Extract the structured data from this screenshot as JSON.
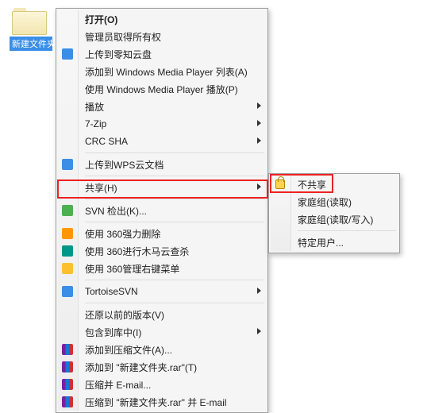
{
  "desktop": {
    "folder_label": "新建文件夹"
  },
  "menu": {
    "open": "打开(O)",
    "admin_owner": "管理员取得所有权",
    "upload_cloud": "上传到零知云盘",
    "wmp_list": "添加到 Windows Media Player 列表(A)",
    "wmp_play": "使用 Windows Media Player 播放(P)",
    "play": "播放",
    "seven_zip": "7-Zip",
    "crc_sha": "CRC SHA",
    "upload_wps": "上传到WPS云文档",
    "share": "共享(H)",
    "svn_checkout": "SVN 检出(K)...",
    "use_360_force_delete": "使用 360强力删除",
    "use_360_trojan_scan": "使用 360进行木马云查杀",
    "use_360_context_menu": "使用 360管理右键菜单",
    "tortoise_svn": "TortoiseSVN",
    "restore_previous": "还原以前的版本(V)",
    "include_in_library": "包含到库中(I)",
    "add_to_archive": "添加到压缩文件(A)...",
    "add_to_named_rar": "添加到 \"新建文件夹.rar\"(T)",
    "compress_email": "压缩并 E-mail...",
    "compress_named_email": "压缩到 \"新建文件夹.rar\" 并 E-mail"
  },
  "submenu": {
    "no_share": "不共享",
    "homegroup_read": "家庭组(读取)",
    "homegroup_rw": "家庭组(读取/写入)",
    "specific_users": "特定用户..."
  }
}
